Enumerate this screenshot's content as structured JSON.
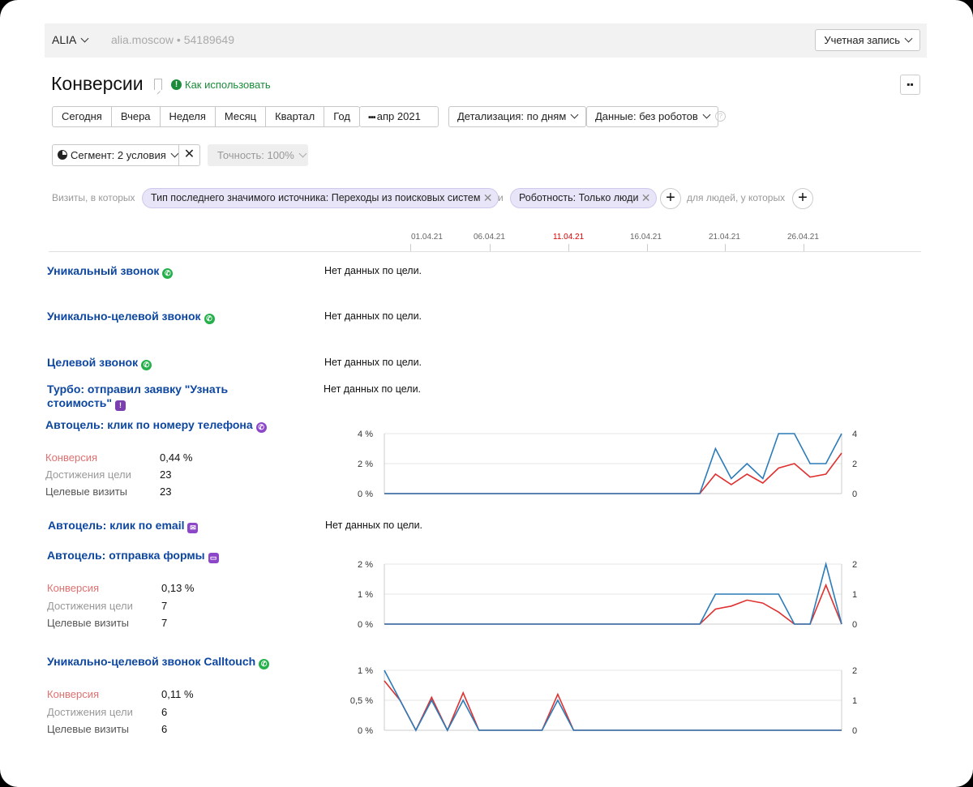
{
  "topbar": {
    "account": "ALIA",
    "site": "alia.moscow",
    "separator": "•",
    "counter_id": "54189649",
    "account_menu": "Учетная запись"
  },
  "header": {
    "title": "Конверсии",
    "howto": "Как использовать"
  },
  "periods": [
    "Сегодня",
    "Вчера",
    "Неделя",
    "Месяц",
    "Квартал",
    "Год"
  ],
  "controls": {
    "date_range": "апр 2021",
    "detail": "Детализация: по дням",
    "data": "Данные: без роботов",
    "segment": "Сегмент: 2 условия",
    "accuracy": "Точность: 100%"
  },
  "filters": {
    "prefix": "Визиты, в которых",
    "chip1": "Тип последнего значимого источника: Переходы из поисковых систем",
    "joiner": "и",
    "chip2": "Роботность: Только люди",
    "people": "для людей, у которых"
  },
  "timeline": {
    "ticks": [
      "01.04.21",
      "06.04.21",
      "11.04.21",
      "16.04.21",
      "21.04.21",
      "26.04.21"
    ],
    "highlight": "11.04.21"
  },
  "colors": {
    "blue": "#2b7bb9",
    "red": "#e03030",
    "title": "#0d47a1",
    "green": "#1a8c3a"
  },
  "labels": {
    "no_data": "Нет данных по цели.",
    "conversion": "Конверсия",
    "achievements": "Достижения цели",
    "target_visits": "Целевые визиты"
  },
  "goals": [
    {
      "title": "Уникальный звонок",
      "icon": "phone-icon"
    },
    {
      "title": "Уникально-целевой звонок",
      "icon": "phone-icon"
    },
    {
      "title": "Целевой звонок",
      "icon": "phone-icon"
    },
    {
      "title": "Турбо: отправил заявку \"Узнать",
      "title2": "стоимость\"",
      "icon": "exclamation-icon"
    },
    {
      "title": "Автоцель: клик по номеру телефона",
      "icon": "phone-icon",
      "conversion": "0,44 %",
      "achievements": "23",
      "visits": "23"
    },
    {
      "title": "Автоцель: клик по email",
      "icon": "email-icon"
    },
    {
      "title": "Автоцель: отправка формы",
      "icon": "form-icon",
      "conversion": "0,13 %",
      "achievements": "7",
      "visits": "7"
    },
    {
      "title": "Уникально-целевой звонок Calltouch",
      "icon": "phone-icon",
      "conversion": "0,11 %",
      "achievements": "6",
      "visits": "6"
    }
  ],
  "chart_data": [
    {
      "type": "line",
      "goal": "Автоцель: клик по номеру телефона",
      "x_days": 30,
      "left_ticks": [
        "4 %",
        "2 %",
        "0 %"
      ],
      "right_ticks": [
        "4",
        "2",
        "0"
      ],
      "left_max": 4,
      "right_max": 4,
      "series": [
        {
          "values": [
            0,
            0,
            0,
            0,
            0,
            0,
            0,
            0,
            0,
            0,
            0,
            0,
            0,
            0,
            0,
            0,
            0,
            0,
            0,
            0,
            0,
            3,
            1,
            2,
            1,
            4,
            4,
            2,
            2,
            4
          ]
        },
        {
          "values": [
            0,
            0,
            0,
            0,
            0,
            0,
            0,
            0,
            0,
            0,
            0,
            0,
            0,
            0,
            0,
            0,
            0,
            0,
            0,
            0,
            0,
            1.3,
            0.6,
            1.3,
            0.7,
            1.7,
            2,
            1.1,
            1.3,
            2.7
          ]
        }
      ]
    },
    {
      "type": "line",
      "goal": "Автоцель: отправка формы",
      "x_days": 30,
      "left_ticks": [
        "2 %",
        "1 %",
        "0 %"
      ],
      "right_ticks": [
        "2",
        "1",
        "0"
      ],
      "left_max": 2,
      "right_max": 2,
      "series": [
        {
          "values": [
            0,
            0,
            0,
            0,
            0,
            0,
            0,
            0,
            0,
            0,
            0,
            0,
            0,
            0,
            0,
            0,
            0,
            0,
            0,
            0,
            0,
            1,
            1,
            1,
            1,
            1,
            0,
            0,
            2,
            0
          ]
        },
        {
          "values": [
            0,
            0,
            0,
            0,
            0,
            0,
            0,
            0,
            0,
            0,
            0,
            0,
            0,
            0,
            0,
            0,
            0,
            0,
            0,
            0,
            0,
            0.5,
            0.6,
            0.8,
            0.7,
            0.4,
            0,
            0,
            1.3,
            0
          ]
        }
      ]
    },
    {
      "type": "line",
      "goal": "Уникально-целевой звонок Calltouch",
      "x_days": 30,
      "left_ticks": [
        "1 %",
        "0,5 %",
        "0 %"
      ],
      "right_ticks": [
        "2",
        "1",
        "0"
      ],
      "left_max": 1,
      "right_max": 2,
      "series": [
        {
          "values": [
            2,
            1,
            0,
            1,
            0,
            1,
            0,
            0,
            0,
            0,
            0,
            1,
            0,
            0,
            0,
            0,
            0,
            0,
            0,
            0,
            0,
            0,
            0,
            0,
            0,
            0,
            0,
            0,
            0,
            0
          ]
        },
        {
          "values": [
            1.65,
            1,
            0,
            1.1,
            0,
            1.25,
            0,
            0,
            0,
            0,
            0,
            1.2,
            0,
            0,
            0,
            0,
            0,
            0,
            0,
            0,
            0,
            0,
            0,
            0,
            0,
            0,
            0,
            0,
            0,
            0
          ]
        }
      ]
    }
  ]
}
